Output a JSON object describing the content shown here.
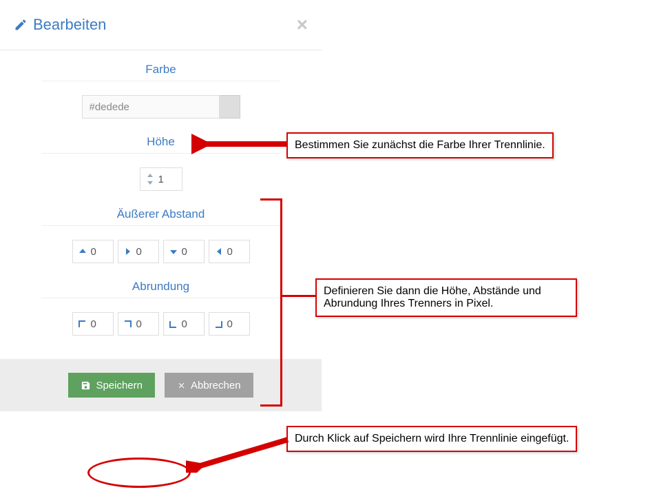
{
  "header": {
    "title": "Bearbeiten"
  },
  "sections": {
    "color": {
      "label": "Farbe",
      "value": "#dedede"
    },
    "height": {
      "label": "Höhe",
      "value": "1"
    },
    "margin": {
      "label": "Äußerer Abstand",
      "top": "0",
      "right": "0",
      "bottom": "0",
      "left": "0"
    },
    "radius": {
      "label": "Abrundung",
      "tl": "0",
      "tr": "0",
      "bl": "0",
      "br": "0"
    }
  },
  "footer": {
    "save": "Speichern",
    "cancel": "Abbrechen"
  },
  "callouts": {
    "c1": "Bestimmen Sie zunächst die Farbe Ihrer Trennlinie.",
    "c2": "Definieren Sie dann die Höhe, Abstände und Abrundung Ihres Trenners in Pixel.",
    "c3": "Durch Klick auf Speichern wird Ihre Trennlinie eingefügt."
  }
}
